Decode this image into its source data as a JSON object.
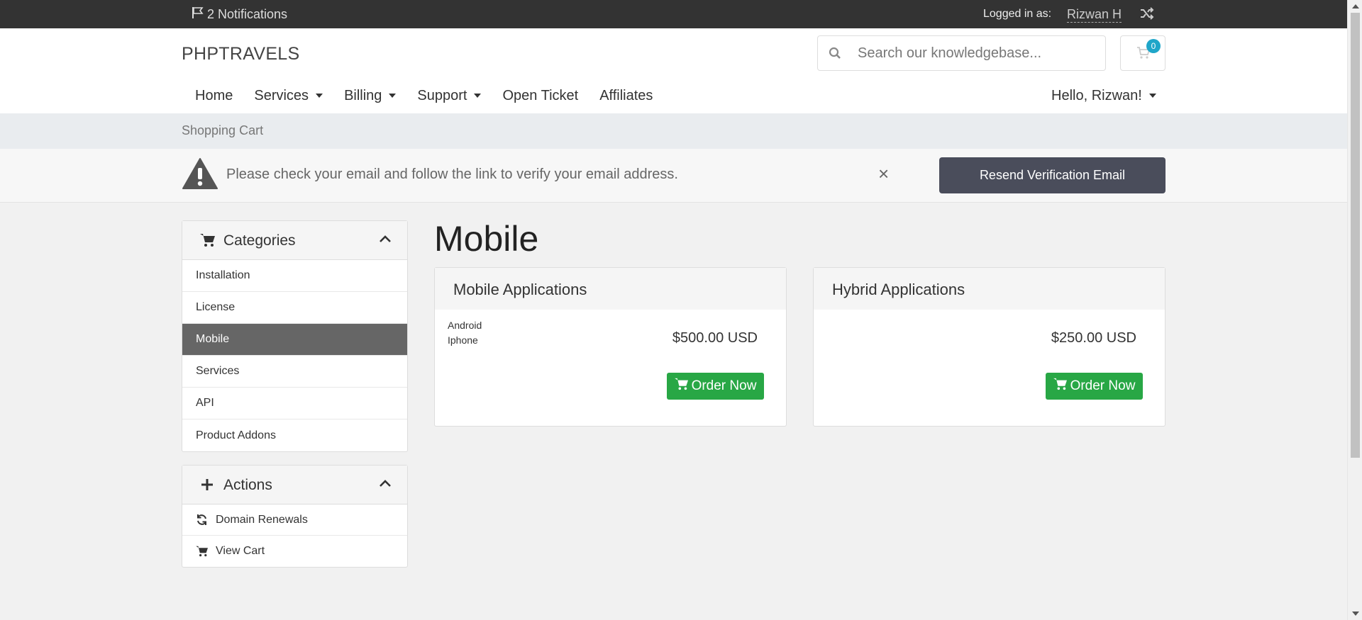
{
  "topbar": {
    "notifications": "2 Notifications",
    "logged_in_label": "Logged in as:",
    "user_name": "Rizwan H"
  },
  "header": {
    "brand": "PHPTRAVELS",
    "search_placeholder": "Search our knowledgebase...",
    "cart_count": "0"
  },
  "nav": {
    "items": [
      {
        "label": "Home",
        "dropdown": false
      },
      {
        "label": "Services",
        "dropdown": true
      },
      {
        "label": "Billing",
        "dropdown": true
      },
      {
        "label": "Support",
        "dropdown": true
      },
      {
        "label": "Open Ticket",
        "dropdown": false
      },
      {
        "label": "Affiliates",
        "dropdown": false
      }
    ],
    "user_menu": "Hello, Rizwan!"
  },
  "breadcrumb": "Shopping Cart",
  "alert": {
    "message": "Please check your email and follow the link to verify your email address.",
    "close": "×",
    "button": "Resend Verification Email"
  },
  "sidebar": {
    "categories": {
      "title": "Categories",
      "items": [
        "Installation",
        "License",
        "Mobile",
        "Services",
        "API",
        "Product Addons"
      ],
      "active": "Mobile"
    },
    "actions": {
      "title": "Actions",
      "items": [
        {
          "label": "Domain Renewals",
          "icon": "refresh-icon"
        },
        {
          "label": "View Cart",
          "icon": "cart-icon"
        }
      ]
    }
  },
  "main": {
    "title": "Mobile",
    "products": [
      {
        "name": "Mobile Applications",
        "features": [
          "Android",
          "Iphone"
        ],
        "price": "$500.00 USD",
        "order_label": "Order Now"
      },
      {
        "name": "Hybrid Applications",
        "features": [],
        "price": "$250.00 USD",
        "order_label": "Order Now"
      }
    ]
  },
  "colors": {
    "topbar_bg": "#333333",
    "active_item_bg": "#666666",
    "order_button": "#28a745",
    "resend_button": "#4a4d5b",
    "badge": "#1fa6c9"
  }
}
